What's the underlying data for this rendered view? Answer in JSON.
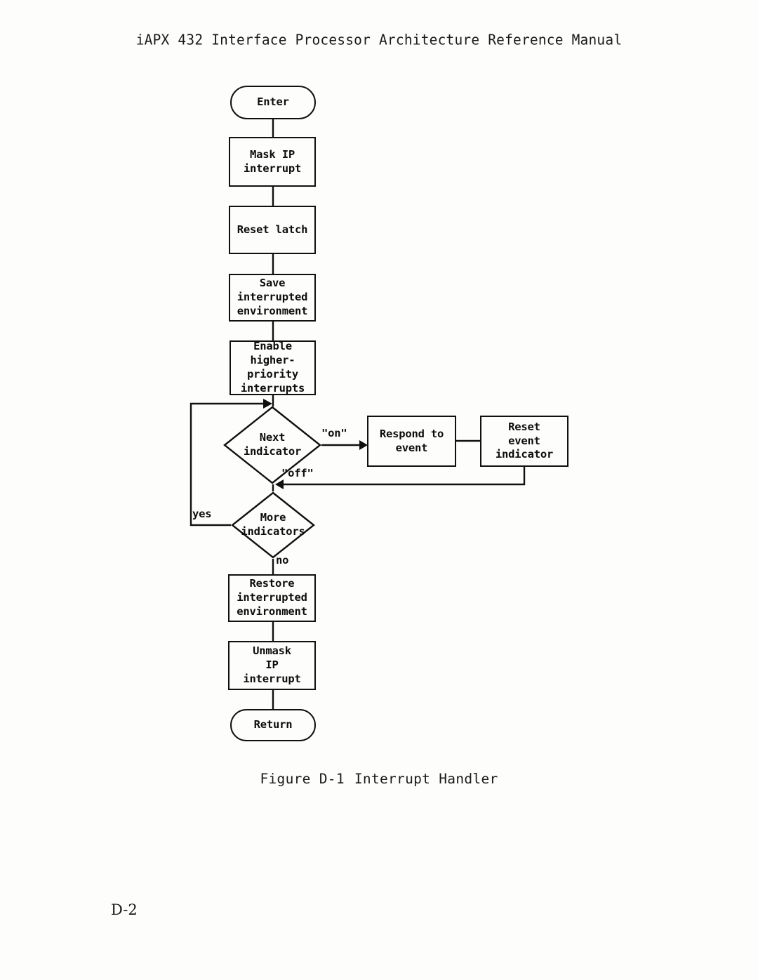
{
  "page": {
    "running_head": "iAPX 432 Interface Processor Architecture Reference Manual",
    "folio": "D-2",
    "background_color": "#fdfdfb",
    "ink_color": "#101010"
  },
  "figure": {
    "caption_number": "Figure D-1",
    "caption_title": "Interrupt Handler"
  },
  "chart_data": {
    "type": "diagram",
    "title": "Interrupt Handler",
    "nodes": [
      {
        "id": "enter",
        "shape": "terminal",
        "label": "Enter"
      },
      {
        "id": "mask",
        "shape": "process",
        "label": "Mask IP\ninterrupt"
      },
      {
        "id": "reset_latch",
        "shape": "process",
        "label": "Reset latch"
      },
      {
        "id": "save_env",
        "shape": "process",
        "label": "Save\ninterrupted\nenvironment"
      },
      {
        "id": "enable_higher",
        "shape": "process",
        "label": "Enable\nhigher-\npriority\ninterrupts"
      },
      {
        "id": "next_indicator",
        "shape": "decision",
        "label": "Next\nindicator"
      },
      {
        "id": "respond",
        "shape": "process",
        "label": "Respond to\nevent"
      },
      {
        "id": "reset_event",
        "shape": "process",
        "label": "Reset\nevent\nindicator"
      },
      {
        "id": "more_indicators",
        "shape": "decision",
        "label": "More\nindicators"
      },
      {
        "id": "restore_env",
        "shape": "process",
        "label": "Restore\ninterrupted\nenvironment"
      },
      {
        "id": "unmask",
        "shape": "process",
        "label": "Unmask\nIP\ninterrupt"
      },
      {
        "id": "return",
        "shape": "terminal",
        "label": "Return"
      }
    ],
    "edges": [
      {
        "from": "enter",
        "to": "mask",
        "label": ""
      },
      {
        "from": "mask",
        "to": "reset_latch",
        "label": ""
      },
      {
        "from": "reset_latch",
        "to": "save_env",
        "label": ""
      },
      {
        "from": "save_env",
        "to": "enable_higher",
        "label": ""
      },
      {
        "from": "enable_higher",
        "to": "next_indicator",
        "label": ""
      },
      {
        "from": "next_indicator",
        "to": "respond",
        "label": "\"on\""
      },
      {
        "from": "respond",
        "to": "reset_event",
        "label": ""
      },
      {
        "from": "reset_event",
        "to": "more_indicators",
        "label": ""
      },
      {
        "from": "next_indicator",
        "to": "more_indicators",
        "label": "\"off\""
      },
      {
        "from": "more_indicators",
        "to": "next_indicator",
        "label": "yes"
      },
      {
        "from": "more_indicators",
        "to": "restore_env",
        "label": "no"
      },
      {
        "from": "restore_env",
        "to": "unmask",
        "label": ""
      },
      {
        "from": "unmask",
        "to": "return",
        "label": ""
      }
    ],
    "edge_labels": {
      "on": "\"on\"",
      "off": "\"off\"",
      "yes": "yes",
      "no": "no"
    }
  }
}
